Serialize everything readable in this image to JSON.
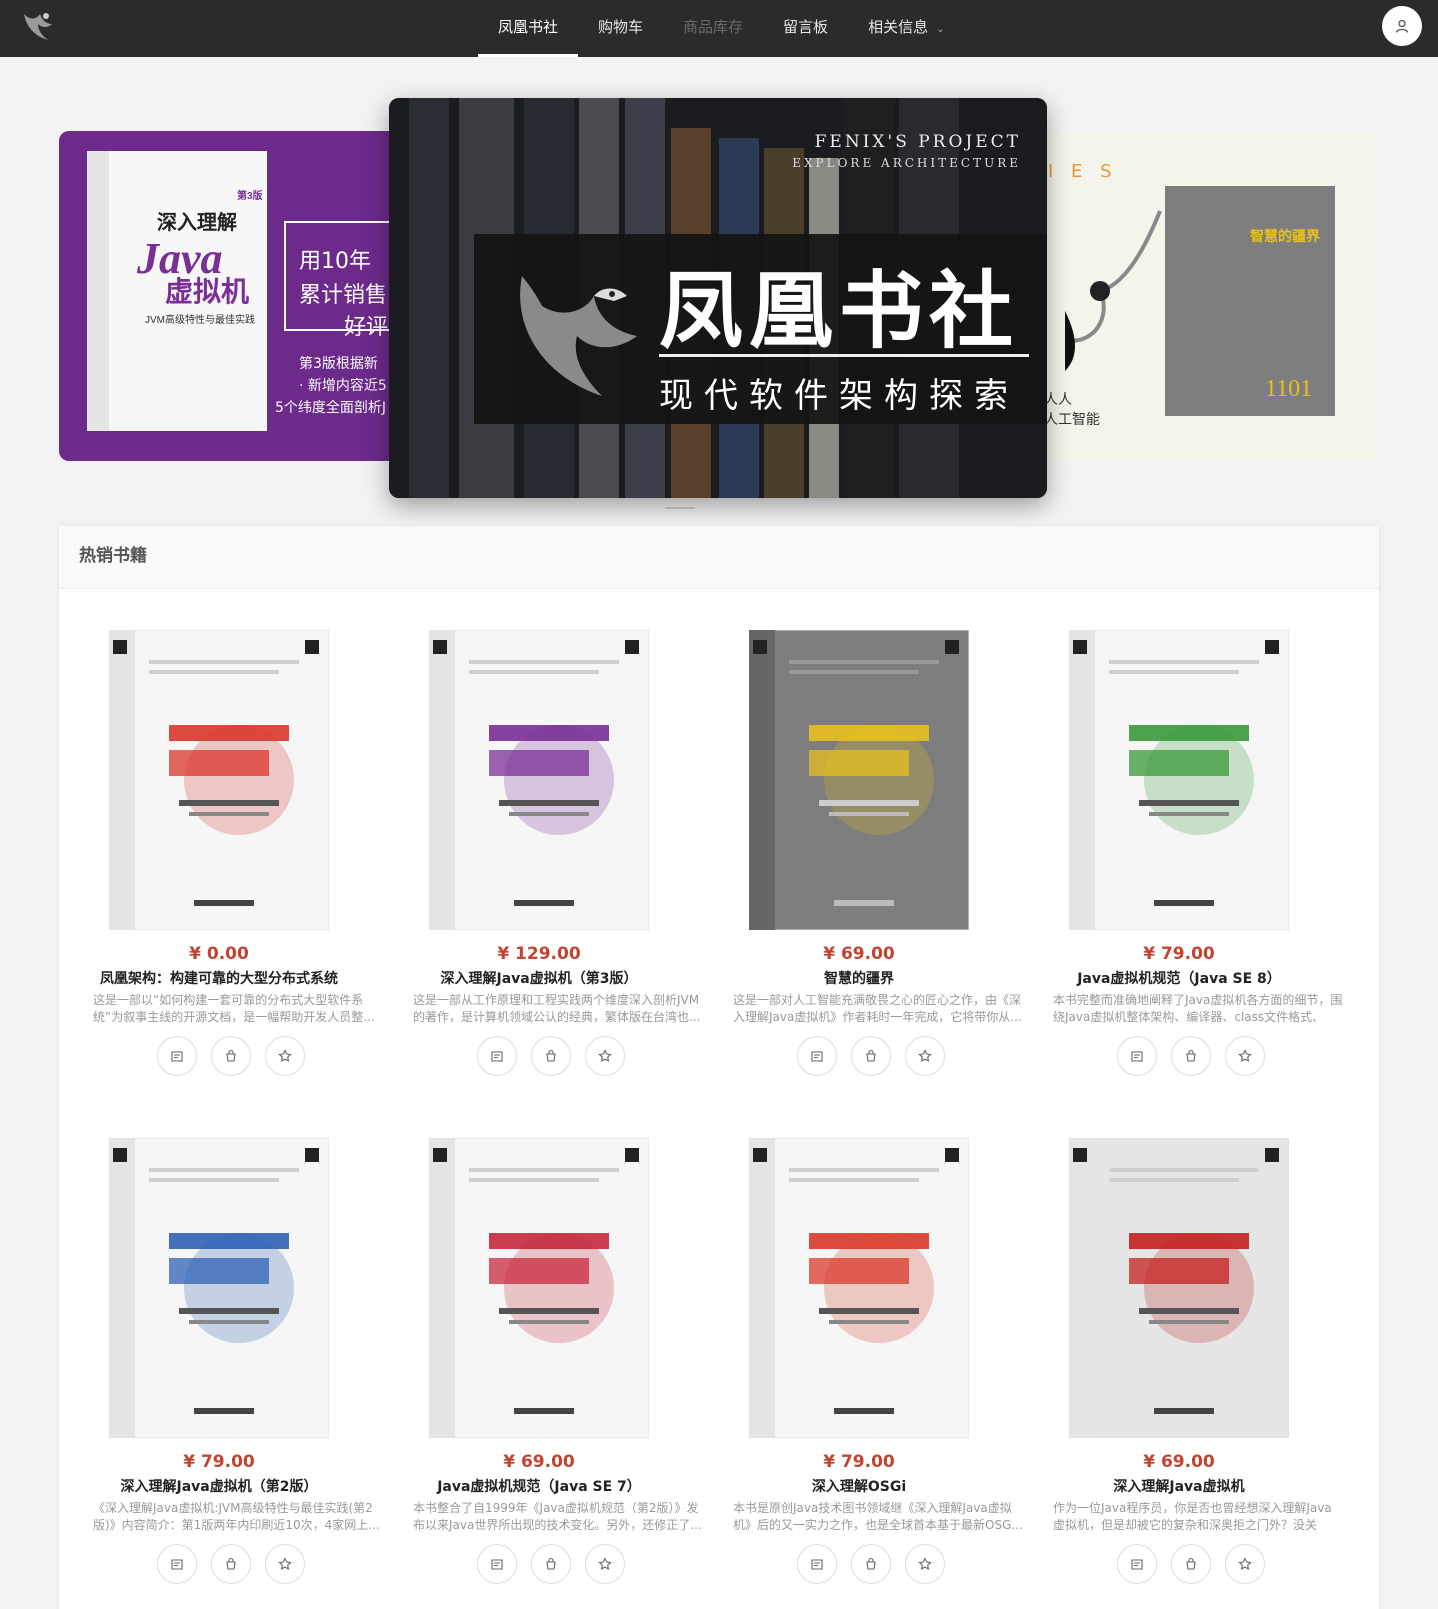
{
  "nav": {
    "items": [
      {
        "label": "凤凰书社",
        "state": "active"
      },
      {
        "label": "购物车",
        "state": "normal"
      },
      {
        "label": "商品库存",
        "state": "disabled"
      },
      {
        "label": "留言板",
        "state": "normal"
      },
      {
        "label": "相关信息",
        "state": "normal"
      }
    ],
    "logo_icon": "phoenix-logo-icon",
    "user_icon": "user-icon"
  },
  "banner": {
    "left": {
      "lines": [
        "用10年",
        "累计销售",
        "好评",
        "第3版根据新",
        "· 新增内容近5",
        "5个纬度全面剖析J"
      ],
      "bg": "#6c2a8b"
    },
    "center": {
      "sub1": "FENIX'S PROJECT",
      "sub2": "EXPLORE ARCHITECTURE",
      "title": "凤凰书社",
      "slogan": "现代软件架构探索"
    },
    "right": {
      "letters": "I E S",
      "text1": "们人人",
      "text2": "懂人工智能",
      "bg": "#f4f4ea"
    }
  },
  "hot": {
    "heading": "热销书籍",
    "books": [
      {
        "price": "¥ 0.00",
        "title": "凤凰架构：构建可靠的大型分布式系统",
        "desc": "这是一部以“如何构建一套可靠的分布式大型软件系统”为叙事主线的开源文档，是一幅帮助开发人员整...",
        "cover": "#f6f6f6",
        "accent": "#d9362a"
      },
      {
        "price": "¥ 129.00",
        "title": "深入理解Java虚拟机（第3版）",
        "desc": "这是一部从工作原理和工程实践两个维度深入剖析JVM的著作，是计算机领域公认的经典，繁体版在台湾也...",
        "cover": "#f6f6f6",
        "accent": "#7a2f96"
      },
      {
        "price": "¥ 69.00",
        "title": "智慧的疆界",
        "desc": "这是一部对人工智能充满敬畏之心的匠心之作，由《深入理解Java虚拟机》作者耗时一年完成，它将带你从...",
        "cover": "#7d7d7d",
        "accent": "#e8c020"
      },
      {
        "price": "¥ 79.00",
        "title": "Java虚拟机规范（Java SE 8）",
        "desc": "本书完整而准确地阐释了Java虚拟机各方面的细节，围绕Java虚拟机整体架构、编译器、class文件格式、加...",
        "cover": "#f6f6f6",
        "accent": "#3a9a3a"
      },
      {
        "price": "¥ 79.00",
        "title": "深入理解Java虚拟机（第2版）",
        "desc": "《深入理解Java虚拟机:JVM高级特性与最佳实践(第2版)》内容简介：第1版两年内印刷近10次，4家网上...",
        "cover": "#f6f6f6",
        "accent": "#2f62b5"
      },
      {
        "price": "¥ 69.00",
        "title": "Java虚拟机规范（Java SE 7）",
        "desc": "本书整合了自1999年《Java虚拟机规范（第2版）》发布以来Java世界所出现的技术变化。另外，还修正了...",
        "cover": "#f6f6f6",
        "accent": "#c8283c"
      },
      {
        "price": "¥ 79.00",
        "title": "深入理解OSGi",
        "desc": "本书是原创Java技术图书领域继《深入理解Java虚拟机》后的又一实力之作，也是全球首本基于最新OSG...",
        "cover": "#f6f6f6",
        "accent": "#d93a2a"
      },
      {
        "price": "¥ 69.00",
        "title": "深入理解Java虚拟机",
        "desc": "作为一位Java程序员，你是否也曾经想深入理解Java虚拟机，但是却被它的复杂和深奥拒之门外？没关系，...",
        "cover": "#e6e6e6",
        "accent": "#c42020"
      }
    ],
    "action_icons": [
      "book-preview-icon",
      "shopping-bag-icon",
      "star-icon"
    ]
  }
}
